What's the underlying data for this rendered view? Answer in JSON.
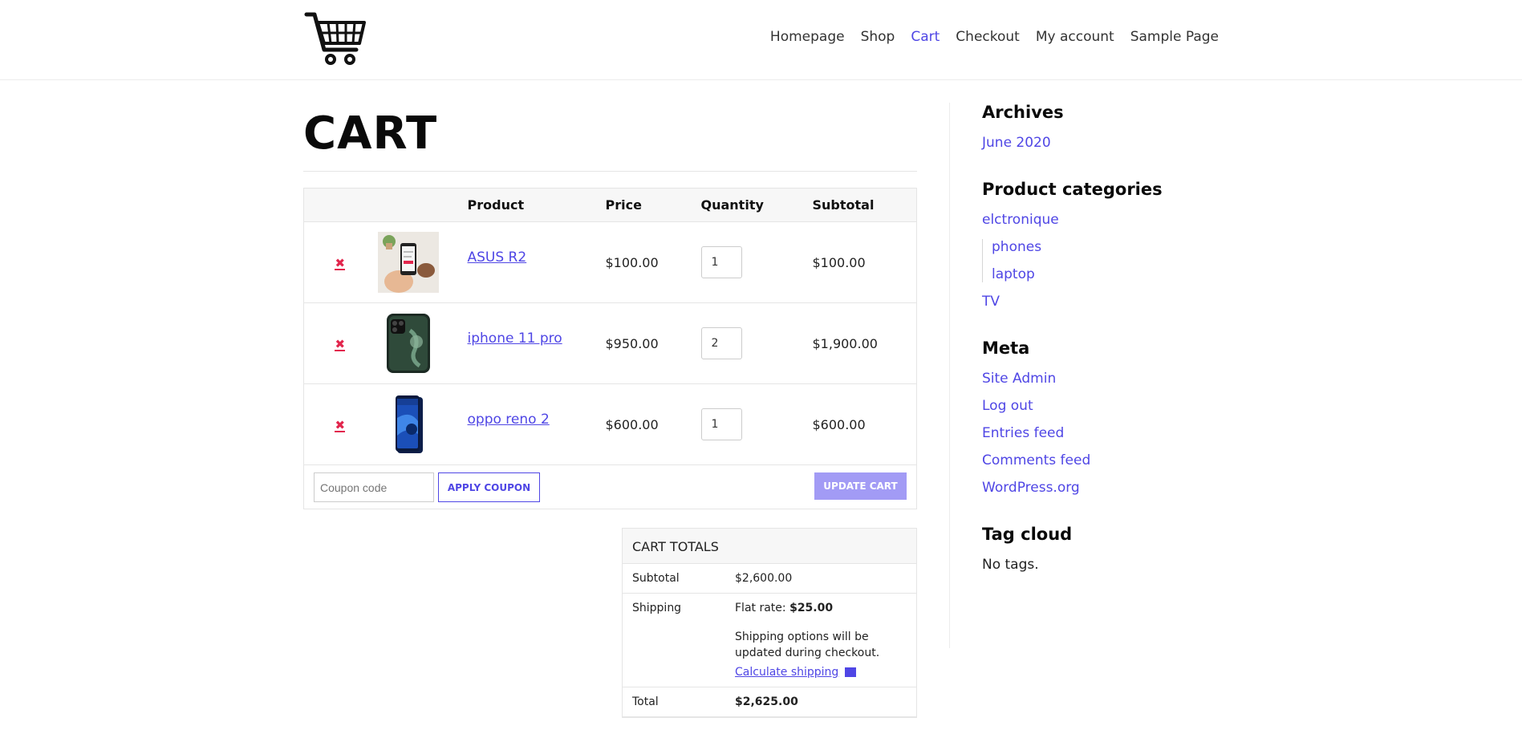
{
  "nav": {
    "items": [
      {
        "label": "Homepage",
        "active": false
      },
      {
        "label": "Shop",
        "active": false
      },
      {
        "label": "Cart",
        "active": true
      },
      {
        "label": "Checkout",
        "active": false
      },
      {
        "label": "My account",
        "active": false
      },
      {
        "label": "Sample Page",
        "active": false
      }
    ]
  },
  "page": {
    "title": "CART"
  },
  "cart": {
    "headers": {
      "product": "Product",
      "price": "Price",
      "quantity": "Quantity",
      "subtotal": "Subtotal"
    },
    "items": [
      {
        "name": "ASUS R2",
        "price": "$100.00",
        "qty": "1",
        "subtotal": "$100.00"
      },
      {
        "name": "iphone 11 pro",
        "price": "$950.00",
        "qty": "2",
        "subtotal": "$1,900.00"
      },
      {
        "name": "oppo reno 2",
        "price": "$600.00",
        "qty": "1",
        "subtotal": "$600.00"
      }
    ],
    "remove_symbol": "✖",
    "coupon_placeholder": "Coupon code",
    "apply_label": "APPLY COUPON",
    "update_label": "UPDATE CART"
  },
  "totals": {
    "heading": "CART TOTALS",
    "subtotal_label": "Subtotal",
    "subtotal_value": "$2,600.00",
    "shipping_label": "Shipping",
    "shipping_prefix": "Flat rate: ",
    "shipping_value": "$25.00",
    "shipping_note": "Shipping options will be updated during checkout.",
    "calc_link": "Calculate shipping",
    "total_label": "Total",
    "total_value": "$2,625.00"
  },
  "sidebar": {
    "archives": {
      "title": "Archives",
      "items": [
        "June 2020"
      ]
    },
    "categories": {
      "title": "Product categories",
      "items": [
        "elctronique",
        "phones",
        "laptop",
        "TV"
      ]
    },
    "meta": {
      "title": "Meta",
      "items": [
        "Site Admin",
        "Log out",
        "Entries feed",
        "Comments feed",
        "WordPress.org"
      ]
    },
    "tags": {
      "title": "Tag cloud",
      "empty": "No tags."
    }
  },
  "colors": {
    "accent": "#4f46e5",
    "remove": "#e2264d",
    "update_button": "#a29bf5"
  }
}
